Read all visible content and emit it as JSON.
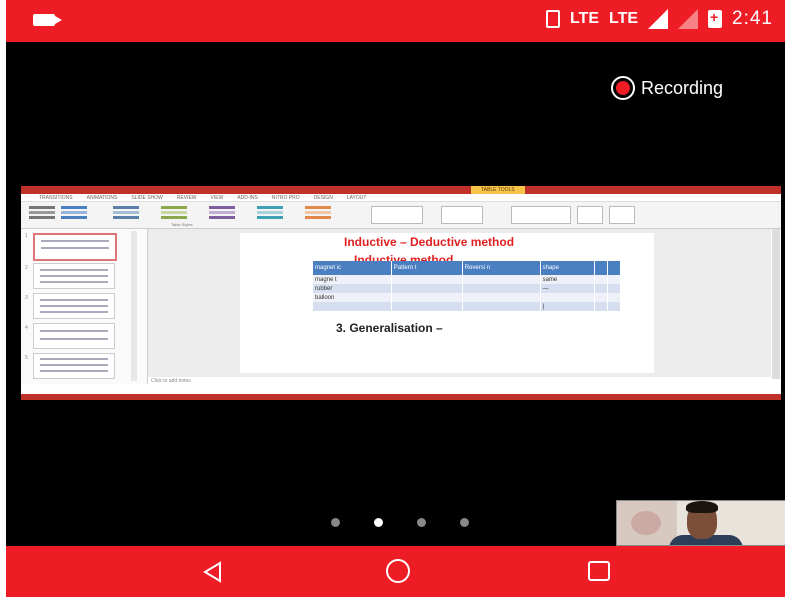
{
  "status_bar": {
    "network_1": "LTE",
    "network_2": "LTE",
    "time": "2:41"
  },
  "recording": {
    "label": "Recording"
  },
  "slide": {
    "title": "Inductive – Deductive method",
    "subtitle": "Inductive method",
    "generalisation": "3. Generalisation –",
    "notes_placeholder": "Click to add notes",
    "table": {
      "headers": [
        "magnet ic",
        "Pattern t",
        "Reversi n",
        "shape",
        "",
        ""
      ],
      "rows": [
        [
          "magne t",
          "",
          "",
          "same",
          "",
          ""
        ],
        [
          "rubber",
          "",
          "",
          "—",
          "",
          ""
        ],
        [
          "balloon",
          "",
          "",
          "",
          "",
          ""
        ],
        [
          "",
          "",
          "",
          "|",
          "",
          ""
        ]
      ]
    }
  },
  "ribbon": {
    "context_tab": "TABLE TOOLS",
    "tabs": [
      "TRANSITIONS",
      "ANIMATIONS",
      "SLIDE SHOW",
      "REVIEW",
      "VIEW",
      "ADD-INS",
      "NITRO PRO",
      "DESIGN",
      "LAYOUT"
    ],
    "group_label": "Table Styles"
  },
  "pager": {
    "count": 4,
    "active_index": 1
  },
  "colors": {
    "accent": "#ee1c24",
    "slide_title": "#e02020",
    "table_header": "#4a7fc1"
  }
}
